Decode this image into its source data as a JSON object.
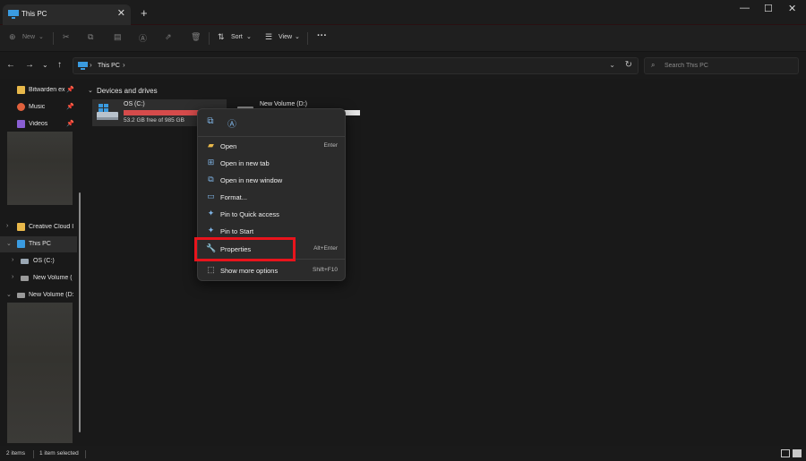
{
  "window": {
    "tab_title": "This PC",
    "tab_close": "✕",
    "new_tab": "+",
    "minimize": "—",
    "maximize": "☐",
    "close": "✕"
  },
  "toolbar": {
    "new_label": "New",
    "sort_label": "Sort",
    "view_label": "View",
    "more_label": "···"
  },
  "address": {
    "crumb": "This PC",
    "search_placeholder": "Search This PC"
  },
  "sidebar": {
    "items": [
      {
        "label": "Bitwarden ex",
        "icon": "folder-icon",
        "pinned": true
      },
      {
        "label": "Music",
        "icon": "music-icon",
        "pinned": true
      },
      {
        "label": "Videos",
        "icon": "videos-icon",
        "pinned": true
      },
      {
        "label": "Creative Cloud I",
        "icon": "creative-cloud-folder-icon"
      },
      {
        "label": "This PC",
        "icon": "pc-icon",
        "selected": true
      },
      {
        "label": "OS (C:)",
        "icon": "drive-icon"
      },
      {
        "label": "New Volume (",
        "icon": "drive-icon"
      },
      {
        "label": "New Volume (D:",
        "icon": "drive-icon"
      }
    ]
  },
  "content": {
    "section_title": "Devices and drives",
    "drive_c": {
      "name": "OS (C:)",
      "free_text": "53.2 GB free of 985 GB",
      "used_fraction": 0.946
    },
    "drive_d": {
      "name": "New Volume (D:)",
      "used_fraction": 1.0
    }
  },
  "context_menu": {
    "items": [
      {
        "label": "Open",
        "shortcut": "Enter",
        "icon": "folder-open-icon"
      },
      {
        "label": "Open in new tab",
        "shortcut": "",
        "icon": "new-tab-icon"
      },
      {
        "label": "Open in new window",
        "shortcut": "",
        "icon": "new-window-icon"
      },
      {
        "label": "Format...",
        "shortcut": "",
        "icon": "format-icon"
      },
      {
        "label": "Pin to Quick access",
        "shortcut": "",
        "icon": "pin-icon"
      },
      {
        "label": "Pin to Start",
        "shortcut": "",
        "icon": "pin-icon"
      },
      {
        "label": "Properties",
        "shortcut": "Alt+Enter",
        "icon": "wrench-icon"
      },
      {
        "label": "Show more options",
        "shortcut": "Shift+F10",
        "icon": "more-options-icon"
      }
    ]
  },
  "status": {
    "items_count": "2 items",
    "selected": "1 item selected"
  },
  "colors": {
    "highlight": "#e8141c",
    "drive_fill_critical": "#d54b4b",
    "accent_icon": "#7fb4e6"
  }
}
